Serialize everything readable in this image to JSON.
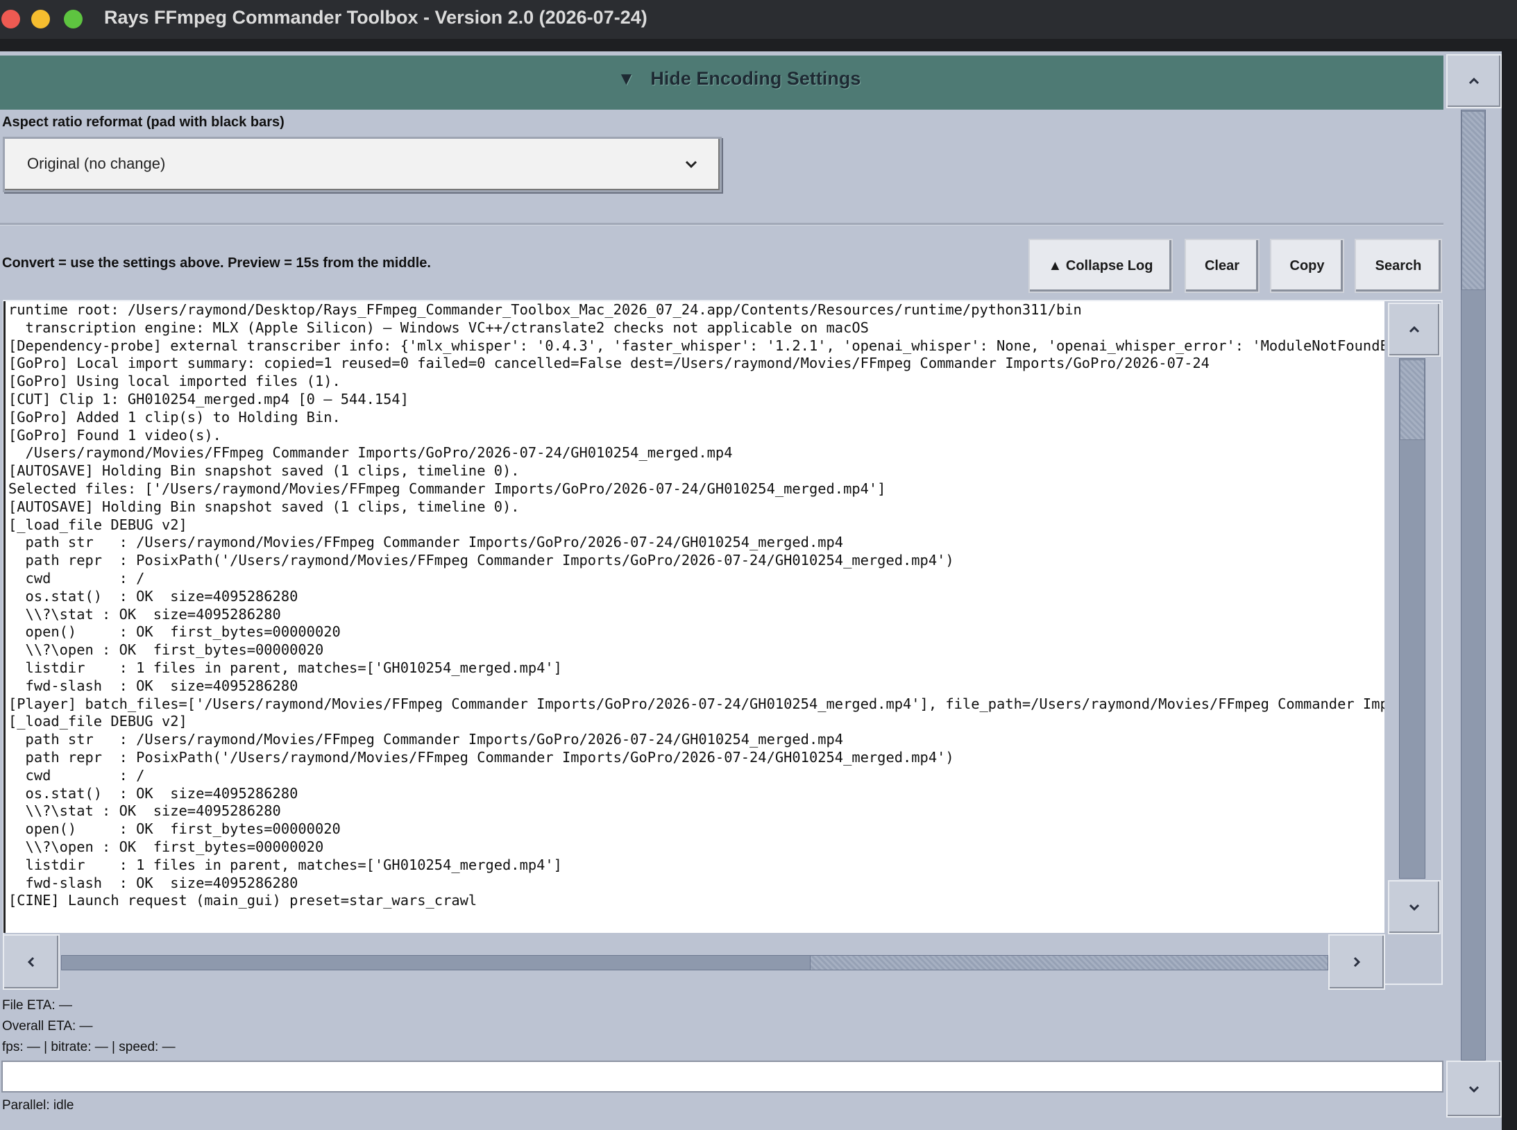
{
  "window": {
    "title": "Rays FFmpeg Commander Toolbox - Version 2.0 (2026-07-24)"
  },
  "encoding_toggle": {
    "icon": "▼",
    "label": "Hide Encoding Settings"
  },
  "aspect": {
    "label": "Aspect ratio reformat (pad with black bars)",
    "selected": "Original (no change)"
  },
  "hint": "Convert = use the settings above.  Preview = 15s from the middle.",
  "log_toolbar": {
    "collapse_label": "▲ Collapse Log",
    "clear_label": "Clear",
    "copy_label": "Copy",
    "search_label": "Search"
  },
  "log_lines": [
    "runtime root: /Users/raymond/Desktop/Rays_FFmpeg_Commander_Toolbox_Mac_2026_07_24.app/Contents/Resources/runtime/python311/bin",
    "  transcription engine: MLX (Apple Silicon) — Windows VC++/ctranslate2 checks not applicable on macOS",
    "[Dependency-probe] external transcriber info: {'mlx_whisper': '0.4.3', 'faster_whisper': '1.2.1', 'openai_whisper': None, 'openai_whisper_error': 'ModuleNotFoundError",
    "[GoPro] Local import summary: copied=1 reused=0 failed=0 cancelled=False dest=/Users/raymond/Movies/FFmpeg Commander Imports/GoPro/2026-07-24",
    "[GoPro] Using local imported files (1).",
    "[CUT] Clip 1: GH010254_merged.mp4 [0 – 544.154]",
    "[GoPro] Added 1 clip(s) to Holding Bin.",
    "[GoPro] Found 1 video(s).",
    "  /Users/raymond/Movies/FFmpeg Commander Imports/GoPro/2026-07-24/GH010254_merged.mp4",
    "[AUTOSAVE] Holding Bin snapshot saved (1 clips, timeline 0).",
    "Selected files: ['/Users/raymond/Movies/FFmpeg Commander Imports/GoPro/2026-07-24/GH010254_merged.mp4']",
    "[AUTOSAVE] Holding Bin snapshot saved (1 clips, timeline 0).",
    "[_load_file DEBUG v2]",
    "  path str   : /Users/raymond/Movies/FFmpeg Commander Imports/GoPro/2026-07-24/GH010254_merged.mp4",
    "  path repr  : PosixPath('/Users/raymond/Movies/FFmpeg Commander Imports/GoPro/2026-07-24/GH010254_merged.mp4')",
    "  cwd        : /",
    "  os.stat()  : OK  size=4095286280",
    "  \\\\?\\stat : OK  size=4095286280",
    "  open()     : OK  first_bytes=00000020",
    "  \\\\?\\open : OK  first_bytes=00000020",
    "  listdir    : 1 files in parent, matches=['GH010254_merged.mp4']",
    "  fwd-slash  : OK  size=4095286280",
    "[Player] batch_files=['/Users/raymond/Movies/FFmpeg Commander Imports/GoPro/2026-07-24/GH010254_merged.mp4'], file_path=/Users/raymond/Movies/FFmpeg Commander Imports",
    "[_load_file DEBUG v2]",
    "  path str   : /Users/raymond/Movies/FFmpeg Commander Imports/GoPro/2026-07-24/GH010254_merged.mp4",
    "  path repr  : PosixPath('/Users/raymond/Movies/FFmpeg Commander Imports/GoPro/2026-07-24/GH010254_merged.mp4')",
    "  cwd        : /",
    "  os.stat()  : OK  size=4095286280",
    "  \\\\?\\stat : OK  size=4095286280",
    "  open()     : OK  first_bytes=00000020",
    "  \\\\?\\open : OK  first_bytes=00000020",
    "  listdir    : 1 files in parent, matches=['GH010254_merged.mp4']",
    "  fwd-slash  : OK  size=4095286280",
    "[CINE] Launch request (main_gui) preset=star_wars_crawl"
  ],
  "status": {
    "file_eta": "File ETA: —",
    "overall_eta": "Overall ETA: —",
    "fps_line": "fps: — | bitrate: — | speed: —",
    "parallel": "Parallel: idle"
  },
  "icons": {
    "traffic_red": "close-icon",
    "traffic_yellow": "minimize-icon",
    "traffic_green": "zoom-icon",
    "scroll_up": "chevron-up-icon",
    "scroll_down": "chevron-down-icon",
    "scroll_left": "chevron-left-icon",
    "scroll_right": "chevron-right-icon"
  },
  "colors": {
    "header_teal": "#4e7a74",
    "window_bg": "#bcc3d2",
    "titlebar": "#2b2d31"
  }
}
